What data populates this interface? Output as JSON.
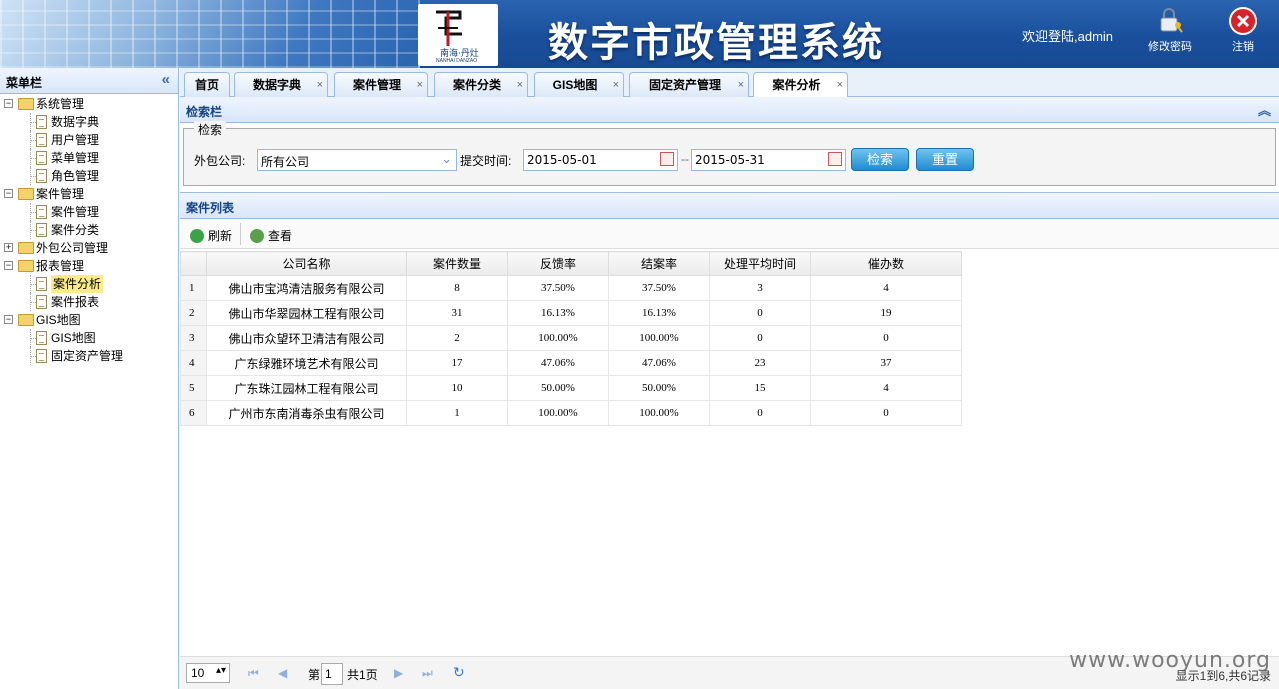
{
  "header": {
    "logo_cn": "南海·丹灶",
    "logo_en": "NANHAI DANZAO",
    "title": "数字市政管理系统",
    "welcome": "欢迎登陆,admin",
    "change_password": "修改密码",
    "logout": "注销"
  },
  "sidebar": {
    "title": "菜单栏",
    "items": [
      {
        "label": "系统管理",
        "level": 0,
        "type": "folder",
        "state": "open"
      },
      {
        "label": "数据字典",
        "level": 1,
        "type": "file"
      },
      {
        "label": "用户管理",
        "level": 1,
        "type": "file"
      },
      {
        "label": "菜单管理",
        "level": 1,
        "type": "file"
      },
      {
        "label": "角色管理",
        "level": 1,
        "type": "file"
      },
      {
        "label": "案件管理",
        "level": 0,
        "type": "folder",
        "state": "open"
      },
      {
        "label": "案件管理",
        "level": 1,
        "type": "file"
      },
      {
        "label": "案件分类",
        "level": 1,
        "type": "file"
      },
      {
        "label": "外包公司管理",
        "level": 0,
        "type": "folder",
        "state": "closed"
      },
      {
        "label": "报表管理",
        "level": 0,
        "type": "folder",
        "state": "open"
      },
      {
        "label": "案件分析",
        "level": 1,
        "type": "file",
        "selected": true
      },
      {
        "label": "案件报表",
        "level": 1,
        "type": "file"
      },
      {
        "label": "GIS地图",
        "level": 0,
        "type": "folder",
        "state": "open"
      },
      {
        "label": "GIS地图",
        "level": 1,
        "type": "file"
      },
      {
        "label": "固定资产管理",
        "level": 1,
        "type": "file"
      }
    ]
  },
  "tabs": [
    {
      "label": "首页",
      "closable": false
    },
    {
      "label": "数据字典",
      "closable": true
    },
    {
      "label": "案件管理",
      "closable": true
    },
    {
      "label": "案件分类",
      "closable": true
    },
    {
      "label": "GIS地图",
      "closable": true
    },
    {
      "label": "固定资产管理",
      "closable": true
    },
    {
      "label": "案件分析",
      "closable": true,
      "active": true
    }
  ],
  "tab_close_glyph": "×",
  "search": {
    "panel_title": "检索栏",
    "legend": "检索",
    "company_label": "外包公司:",
    "company_value": "所有公司",
    "time_label": "提交时间:",
    "date_from": "2015-05-01",
    "date_sep": "--",
    "date_to": "2015-05-31",
    "search_button": "检索",
    "reset_button": "重置"
  },
  "list": {
    "panel_title": "案件列表",
    "toolbar": {
      "refresh": "刷新",
      "view": "查看"
    },
    "columns": [
      "公司名称",
      "案件数量",
      "反馈率",
      "结案率",
      "处理平均时间",
      "催办数"
    ],
    "rows": [
      {
        "n": "1",
        "cells": [
          "佛山市宝鸿清洁服务有限公司",
          "8",
          "37.50%",
          "37.50%",
          "3",
          "4"
        ]
      },
      {
        "n": "2",
        "cells": [
          "佛山市华翠园林工程有限公司",
          "31",
          "16.13%",
          "16.13%",
          "0",
          "19"
        ]
      },
      {
        "n": "3",
        "cells": [
          "佛山市众望环卫清洁有限公司",
          "2",
          "100.00%",
          "100.00%",
          "0",
          "0"
        ]
      },
      {
        "n": "4",
        "cells": [
          "广东绿雅环境艺术有限公司",
          "17",
          "47.06%",
          "47.06%",
          "23",
          "37"
        ]
      },
      {
        "n": "5",
        "cells": [
          "广东珠江园林工程有限公司",
          "10",
          "50.00%",
          "50.00%",
          "15",
          "4"
        ]
      },
      {
        "n": "6",
        "cells": [
          "广州市东南消毒杀虫有限公司",
          "1",
          "100.00%",
          "100.00%",
          "0",
          "0"
        ]
      }
    ]
  },
  "pager": {
    "page_size": "10",
    "page_prefix": "第",
    "page_current": "1",
    "page_total": "共1页",
    "display_info": "显示1到6,共6记录"
  },
  "watermark": "www.wooyun.org",
  "colors": {
    "header_bg": "#1a4f9c",
    "panel_border": "#99bbe8",
    "button": "#1f8bd2",
    "selected": "#fbec88"
  }
}
